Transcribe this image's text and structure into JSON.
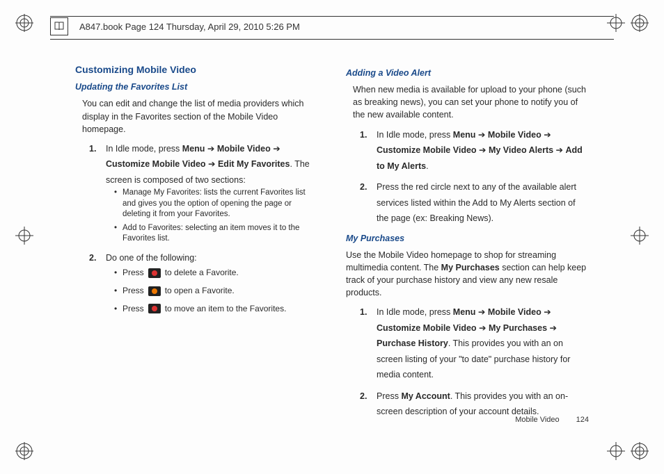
{
  "header": {
    "text": "A847.book  Page 124  Thursday, April 29, 2010  5:26 PM"
  },
  "left": {
    "h2": "Customizing Mobile Video",
    "h3_1": "Updating the Favorites List",
    "p1": "You can edit and change the list of media providers which display in the Favorites section of the Mobile Video homepage.",
    "step1_pre": "In Idle mode, press ",
    "menu": "Menu",
    "mv": "Mobile Video",
    "cmv": "Customize Mobile Video",
    "emf": "Edit My Favorites",
    "step1_post": ". The screen is composed of two sections:",
    "b1": "Manage My Favorites: lists the current Favorites list and gives you the option of opening the page or deleting it from your Favorites.",
    "b2": "Add to Favorites: selecting an item moves it to the Favorites list.",
    "step2": "Do one of the following:",
    "press": "Press",
    "pr1": "to delete a Favorite.",
    "pr2": "to open a Favorite.",
    "pr3": "to move an item to the Favorites."
  },
  "right": {
    "h3_1": "Adding a Video Alert",
    "p1": "When new media is available for upload to your phone (such as breaking news), you can set your phone to notify you of the new available content.",
    "step1_pre": "In Idle mode, press ",
    "menu": "Menu",
    "mv": "Mobile Video",
    "cmv": "Customize Mobile Video",
    "mva": "My Video Alerts",
    "atma": "Add to My Alerts",
    "step2": "Press the red circle next to any of the available alert services listed within the Add to My Alerts section of the page (ex: Breaking News).",
    "h3_2": "My Purchases",
    "p2a": "Use the Mobile Video homepage to shop for streaming multimedia content. The ",
    "mp_bold": "My Purchases",
    "p2b": " section can help keep track of your purchase history and view any new resale products.",
    "mp_step1_pre": "In Idle mode, press ",
    "mp": "My Purchases",
    "ph": "Purchase History",
    "mp_step1_post": ". This provides you with an on screen listing of your \"to date\" purchase history for media content.",
    "mp_step2_pre": "Press ",
    "ma": "My Account",
    "mp_step2_post": ". This provides you with an on-screen description of your account details."
  },
  "footer": {
    "section": "Mobile Video",
    "page": "124"
  }
}
